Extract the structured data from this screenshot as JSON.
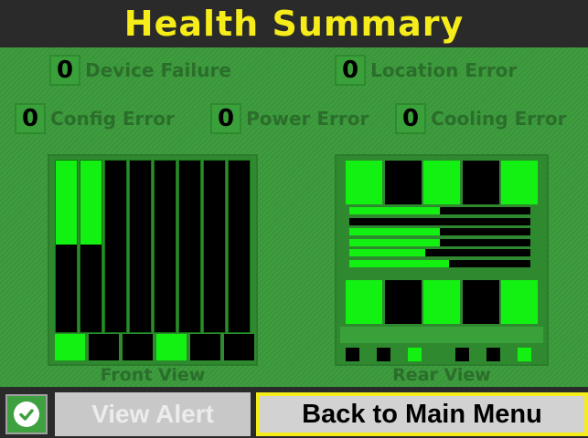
{
  "title": "Health Summary",
  "stats": [
    {
      "count": "0",
      "label": "Device Failure"
    },
    {
      "count": "0",
      "label": "Location Error"
    },
    {
      "count": "0",
      "label": "Config Error"
    },
    {
      "count": "0",
      "label": "Power Error"
    },
    {
      "count": "0",
      "label": "Cooling Error"
    }
  ],
  "front_view": {
    "label": "Front View",
    "bays": [
      {
        "fill": 0.49
      },
      {
        "fill": 0.49
      },
      {
        "fill": 0
      },
      {
        "fill": 0
      },
      {
        "fill": 0
      },
      {
        "fill": 0
      },
      {
        "fill": 0
      },
      {
        "fill": 0
      }
    ],
    "indicators": [
      true,
      false,
      false,
      true,
      false,
      false
    ]
  },
  "rear_view": {
    "label": "Rear View",
    "top_row": [
      true,
      false,
      true,
      false,
      true
    ],
    "bars": [
      0.5,
      0,
      0.5,
      0.5,
      0.42,
      0.55
    ],
    "bottom_row": [
      true,
      false,
      true,
      false,
      true
    ],
    "leds": [
      false,
      false,
      true,
      false,
      false,
      true
    ]
  },
  "footer": {
    "status_icon": "check-icon",
    "view_alert_label": "View Alert",
    "back_label": "Back to Main Menu"
  },
  "colors": {
    "accent": "#f5ec1a",
    "active": "#12f112",
    "panel": "#3f9a3f"
  }
}
